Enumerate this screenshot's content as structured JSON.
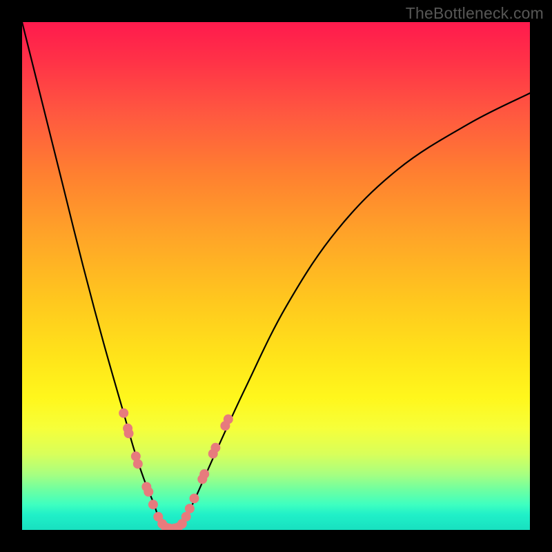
{
  "watermark": "TheBottleneck.com",
  "colors": {
    "dot": "#e77b7d",
    "curve": "#000000",
    "frame": "#000000"
  },
  "chart_data": {
    "type": "line",
    "title": "",
    "xlabel": "",
    "ylabel": "",
    "xlim": [
      0,
      100
    ],
    "ylim": [
      0,
      100
    ],
    "grid": false,
    "series": [
      {
        "name": "bottleneck-curve",
        "x": [
          0,
          4,
          8,
          12,
          16,
          20,
          22,
          24,
          26,
          27,
          28,
          29,
          30,
          31,
          32,
          34,
          38,
          44,
          52,
          62,
          74,
          88,
          100
        ],
        "y": [
          100,
          84,
          68,
          52,
          37,
          23,
          16,
          10,
          5,
          2,
          0.5,
          0,
          0,
          0.5,
          2,
          6,
          15,
          28,
          44,
          59,
          71,
          80,
          86
        ]
      }
    ],
    "dots": {
      "name": "highlighted-points",
      "points": [
        {
          "x": 20.0,
          "y": 23.0
        },
        {
          "x": 20.8,
          "y": 20.0
        },
        {
          "x": 21.0,
          "y": 19.0
        },
        {
          "x": 22.4,
          "y": 14.5
        },
        {
          "x": 22.8,
          "y": 13.0
        },
        {
          "x": 24.5,
          "y": 8.5
        },
        {
          "x": 24.9,
          "y": 7.5
        },
        {
          "x": 25.8,
          "y": 5.0
        },
        {
          "x": 26.8,
          "y": 2.6
        },
        {
          "x": 27.6,
          "y": 1.2
        },
        {
          "x": 28.3,
          "y": 0.5
        },
        {
          "x": 29.0,
          "y": 0.3
        },
        {
          "x": 30.0,
          "y": 0.3
        },
        {
          "x": 30.7,
          "y": 0.5
        },
        {
          "x": 31.5,
          "y": 1.2
        },
        {
          "x": 32.3,
          "y": 2.6
        },
        {
          "x": 33.0,
          "y": 4.2
        },
        {
          "x": 33.9,
          "y": 6.2
        },
        {
          "x": 35.5,
          "y": 10.0
        },
        {
          "x": 35.9,
          "y": 11.0
        },
        {
          "x": 37.6,
          "y": 15.0
        },
        {
          "x": 38.1,
          "y": 16.2
        },
        {
          "x": 40.0,
          "y": 20.5
        },
        {
          "x": 40.6,
          "y": 21.8
        }
      ]
    }
  }
}
